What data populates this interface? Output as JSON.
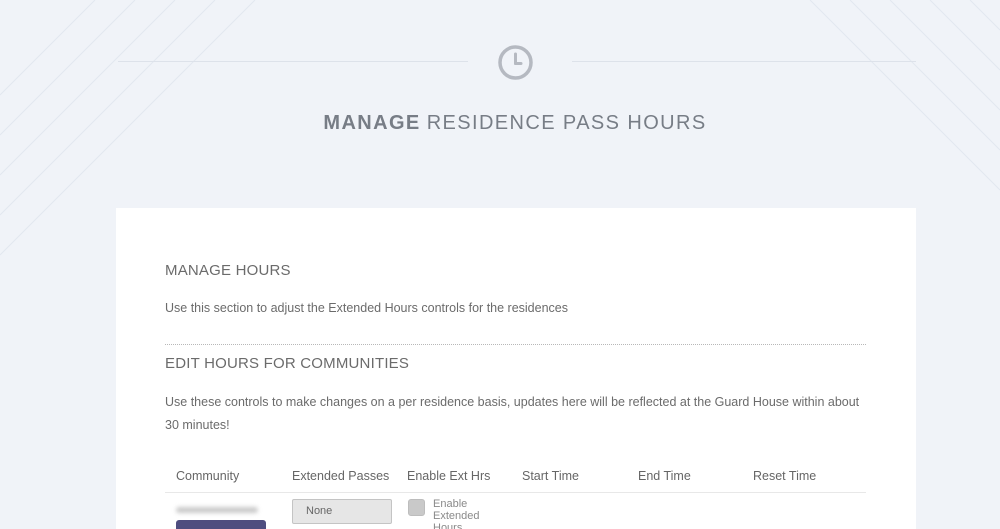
{
  "header": {
    "icon": "clock-icon",
    "title_strong": "MANAGE",
    "title_rest": "RESIDENCE PASS HOURS"
  },
  "manage_hours": {
    "title": "MANAGE HOURS",
    "description": "Use this section to adjust the Extended Hours controls for the residences"
  },
  "edit_hours": {
    "title": "EDIT HOURS FOR COMMUNITIES",
    "description_line1": "Use these controls to make changes on a per residence basis, updates here will be reflected at the Guard House within about",
    "description_line2": "30 minutes!"
  },
  "table": {
    "columns": [
      "Community",
      "Extended Passes",
      "Enable Ext Hrs",
      "Start Time",
      "End Time",
      "Reset Time"
    ],
    "rows": [
      {
        "extended_passes": "None",
        "enable_label": "Enable Extended Hours"
      }
    ]
  },
  "colors": {
    "background": "#f0f3f8",
    "card": "#ffffff",
    "button_purple": "#4e4d7f"
  }
}
